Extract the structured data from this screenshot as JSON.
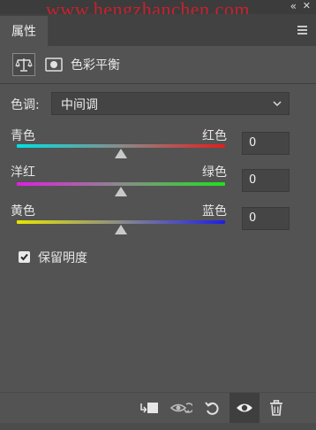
{
  "watermark": "www.hengzhanchen.com",
  "window": {
    "collapse_glyph": "«",
    "close_glyph": "✕"
  },
  "panel": {
    "tab_label": "属性",
    "menu_icon": "panel-menu-icon"
  },
  "adjustment": {
    "title": "色彩平衡",
    "icons": [
      "balance-scale-icon",
      "layer-mask-icon"
    ]
  },
  "tone": {
    "label": "色调:",
    "value": "中间调"
  },
  "sliders": [
    {
      "left_label": "青色",
      "right_label": "红色",
      "value": "0",
      "level": 0,
      "gradient": [
        "#00e1e1",
        "#e11e1e"
      ]
    },
    {
      "left_label": "洋红",
      "right_label": "绿色",
      "value": "0",
      "level": 0,
      "gradient": [
        "#e11ee1",
        "#1ee11e"
      ]
    },
    {
      "left_label": "黄色",
      "right_label": "蓝色",
      "value": "0",
      "level": 0,
      "gradient": [
        "#e6e600",
        "#1e1ee6"
      ]
    }
  ],
  "preserve_luminosity": {
    "label": "保留明度",
    "checked": true
  },
  "bottom_toolbar": {
    "buttons": [
      "clip-to-layer-icon",
      "view-previous-state-icon",
      "reset-icon",
      "visibility-eye-icon",
      "trash-icon"
    ],
    "active": "visibility-eye-icon"
  }
}
